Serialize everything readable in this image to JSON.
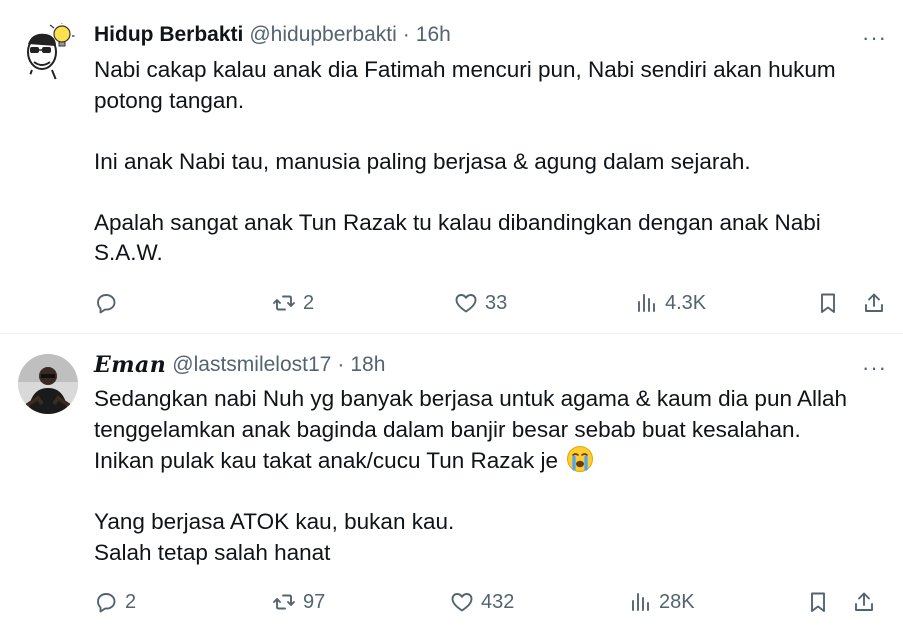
{
  "tweets": [
    {
      "name": "Hidup Berbakti",
      "handle": "@hidupberbakti",
      "separator": "·",
      "time": "16h",
      "more": "···",
      "lines": [
        "Nabi cakap kalau anak dia Fatimah mencuri pun, Nabi sendiri akan hukum",
        "potong tangan.",
        "",
        "Ini anak Nabi tau, manusia paling berjasa & agung dalam sejarah.",
        "",
        "Apalah sangat anak Tun Razak tu kalau dibandingkan dengan anak Nabi",
        "S.A.W."
      ],
      "replies": "",
      "retweets": "2",
      "likes": "33",
      "views": "4.3K"
    },
    {
      "name": "Eman",
      "handle": "@lastsmilelost17",
      "separator": "·",
      "time": "18h",
      "more": "···",
      "lines": [
        "Sedangkan nabi Nuh yg banyak berjasa untuk agama & kaum dia pun Allah",
        "tenggelamkan anak baginda dalam banjir besar sebab buat kesalahan.",
        "Inikan pulak kau takat anak/cucu Tun Razak je",
        "",
        "Yang berjasa ATOK kau, bukan kau.",
        "Salah tetap salah hanat"
      ],
      "emoji": "loudly-crying-face",
      "replies": "2",
      "retweets": "97",
      "likes": "432",
      "views": "28K"
    }
  ],
  "colors": {
    "text": "#0f1419",
    "secondary": "#536471",
    "divider": "#eff3f4"
  }
}
